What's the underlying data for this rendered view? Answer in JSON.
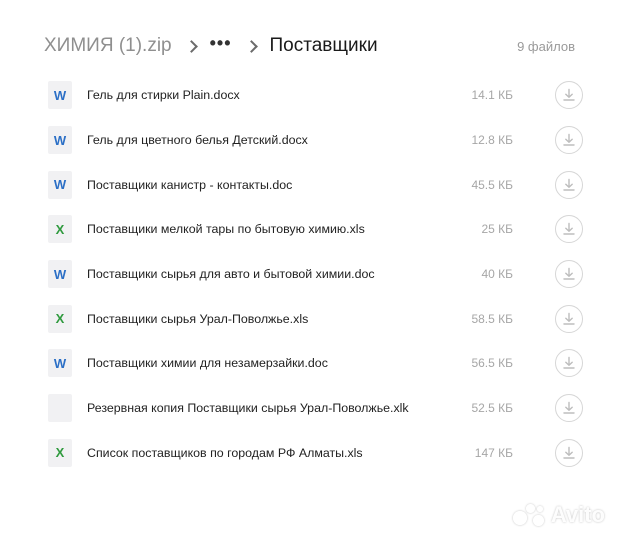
{
  "breadcrumb": {
    "root": "ХИМИЯ (1).zip",
    "ellipsis": "•••",
    "current": "Поставщики"
  },
  "file_count": "9 файлов",
  "icons": {
    "word": "W",
    "excel": "X"
  },
  "files": [
    {
      "name": "Гель для стирки Plain.docx",
      "size": "14.1 КБ",
      "type": "word"
    },
    {
      "name": "Гель для цветного белья Детский.docx",
      "size": "12.8 КБ",
      "type": "word"
    },
    {
      "name": "Поставщики канистр - контакты.doc",
      "size": "45.5 КБ",
      "type": "word"
    },
    {
      "name": "Поставщики мелкой тары по бытовую химию.xls",
      "size": "25 КБ",
      "type": "excel"
    },
    {
      "name": "Поставщики сырья для авто и бытовой химии.doc",
      "size": "40 КБ",
      "type": "word"
    },
    {
      "name": "Поставщики сырья Урал-Поволжье.xls",
      "size": "58.5 КБ",
      "type": "excel"
    },
    {
      "name": "Поставщики химии для незамерзайки.doc",
      "size": "56.5 КБ",
      "type": "word"
    },
    {
      "name": "Резервная копия Поставщики сырья Урал-Поволжье.xlk",
      "size": "52.5 КБ",
      "type": "blank"
    },
    {
      "name": "Список поставщиков по городам РФ Алматы.xls",
      "size": "147 КБ",
      "type": "excel"
    }
  ],
  "watermark": "Avito",
  "colors": {
    "word": "#2b6fc6",
    "excel": "#2f9a3e",
    "muted": "#a6a6a6"
  }
}
